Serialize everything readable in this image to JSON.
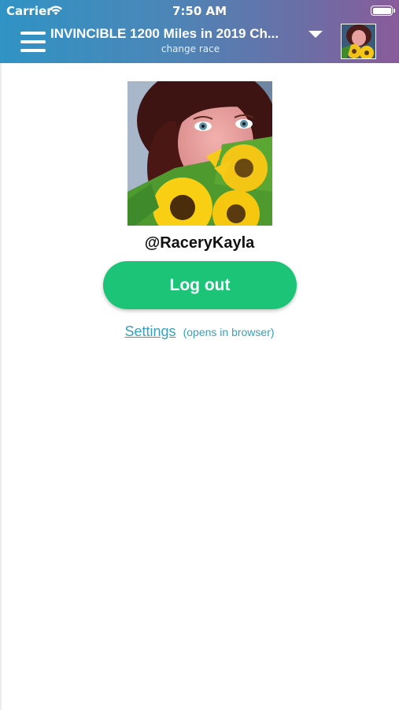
{
  "status_bar": {
    "carrier": "Carrier",
    "time": "7:50 AM",
    "icons": [
      "wifi-icon",
      "battery-icon"
    ]
  },
  "header": {
    "race_title": "INVINCIBLE 1200 Miles in 2019 Ch...",
    "race_subtitle": "change race",
    "gradient_colors": [
      "#2f93c4",
      "#8a5b9a"
    ]
  },
  "profile": {
    "username": "@RaceryKayla"
  },
  "actions": {
    "logout_label": "Log out",
    "logout_color": "#1cc478",
    "settings_label": "Settings",
    "settings_note": "(opens in browser)",
    "link_color": "#3aa0b8"
  }
}
